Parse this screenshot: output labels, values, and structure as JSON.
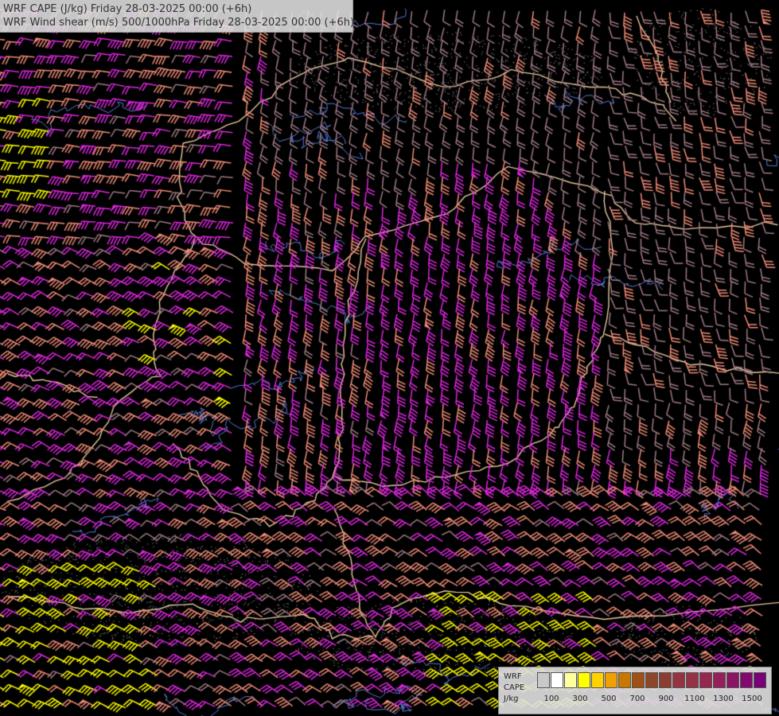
{
  "titles": {
    "line1": "WRF CAPE (J/kg) Friday 28-03-2025 00:00 (+6h)",
    "line2": "WRF Wind shear (m/s) 500/1000hPa Friday 28-03-2025 00:00 (+6h)"
  },
  "legend": {
    "label_line1": "WRF",
    "label_line2": "CAPE",
    "label_line3": "J/kg",
    "colors": [
      "#c8c8c8",
      "#ffffff",
      "#ffffa0",
      "#ffff00",
      "#ffd200",
      "#f0a000",
      "#c87800",
      "#a05014",
      "#8c4628",
      "#8c3c32",
      "#963241",
      "#963246",
      "#962850",
      "#961e5a",
      "#8c1464",
      "#820a6e",
      "#780078"
    ],
    "ticks": [
      "100",
      "300",
      "500",
      "700",
      "900",
      "1100",
      "1300",
      "1500"
    ]
  },
  "map": {
    "background": "#000000",
    "border_color": "#e8c8a0",
    "river_color": "#5a7ad2",
    "barb_colors": {
      "light": "#a07a82",
      "salmon": "#f08c78",
      "magenta": "#dc28dc",
      "yellow": "#ffff00"
    }
  }
}
